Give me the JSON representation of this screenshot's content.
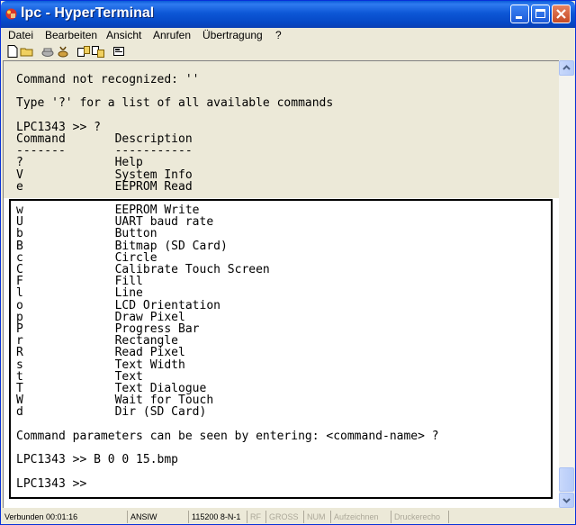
{
  "window": {
    "title": "lpc - HyperTerminal"
  },
  "menu": [
    "Datei",
    "Bearbeiten",
    "Ansicht",
    "Anrufen",
    "Übertragung",
    "?"
  ],
  "toolbar": [
    "new-file-icon",
    "open-folder-icon",
    "connect-phone-icon",
    "disconnect-phone-icon",
    "send-icon",
    "receive-icon",
    "properties-icon"
  ],
  "scrollback_lines": [
    "Command not recognized: ''",
    "",
    "Type '?' for a list of all available commands",
    "",
    "LPC1343 >> ?",
    "Command       Description",
    "-------       -----------",
    "?             Help",
    "V             System Info",
    "e             EEPROM Read"
  ],
  "screen_lines": [
    "w             EEPROM Write",
    "U             UART baud rate",
    "b             Button",
    "B             Bitmap (SD Card)",
    "c             Circle",
    "C             Calibrate Touch Screen",
    "F             Fill",
    "l             Line",
    "o             LCD Orientation",
    "p             Draw Pixel",
    "P             Progress Bar",
    "r             Rectangle",
    "R             Read Pixel",
    "s             Text Width",
    "t             Text",
    "T             Text Dialogue",
    "W             Wait for Touch",
    "d             Dir (SD Card)",
    "",
    "Command parameters can be seen by entering: <command-name> ?",
    "",
    "LPC1343 >> B 0 0 15.bmp",
    "",
    "LPC1343 >>"
  ],
  "status": {
    "connected": "Verbunden 00:01:16",
    "emulation": "ANSIW",
    "port_settings": "115200 8-N-1",
    "rf": "RF",
    "gross": "GROSS",
    "num": "NUM",
    "capture": "Aufzeichnen",
    "printer": "Druckerecho"
  }
}
